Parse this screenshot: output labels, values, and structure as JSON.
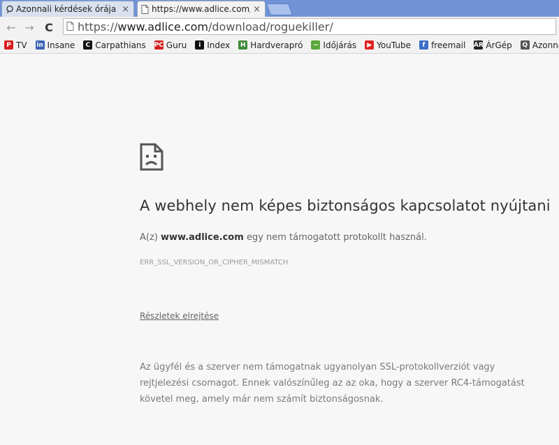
{
  "tabs": [
    {
      "label": "Azonnali kérdések órája",
      "close": "×"
    },
    {
      "label": "https://www.adlice.com/download/roguekiller/",
      "close": "×"
    }
  ],
  "toolbar": {
    "back": "←",
    "forward": "→",
    "reload": "C",
    "url_scheme": "https://",
    "url_host": "www.adlice.com",
    "url_path": "/download/roguekiller/"
  },
  "bookmarks": [
    {
      "label": "TV",
      "icon": "p-icon",
      "color": "#d81e1e",
      "glyph": "P"
    },
    {
      "label": "Insane",
      "icon": "in-icon",
      "color": "#3a63b5",
      "glyph": "in"
    },
    {
      "label": "Carpathians",
      "icon": "c-circle-icon",
      "color": "#111111",
      "glyph": "C"
    },
    {
      "label": "Guru",
      "icon": "pc-icon",
      "color": "#d42020",
      "glyph": "PC"
    },
    {
      "label": "Index",
      "icon": "index-icon",
      "color": "#111111",
      "glyph": "i"
    },
    {
      "label": "Hardverapró",
      "icon": "hardverapro-icon",
      "color": "#3f8a3a",
      "glyph": "H"
    },
    {
      "label": "Időjárás",
      "icon": "frog-icon",
      "color": "#5aa83a",
      "glyph": "~"
    },
    {
      "label": "YouTube",
      "icon": "youtube-icon",
      "color": "#e02424",
      "glyph": "▶"
    },
    {
      "label": "freemail",
      "icon": "freemail-icon",
      "color": "#3b6fc7",
      "glyph": "f"
    },
    {
      "label": "ÁrGép",
      "icon": "argep-icon",
      "color": "#222222",
      "glyph": "ÁR"
    },
    {
      "label": "Azonnali",
      "icon": "azonnali-icon",
      "color": "#555555",
      "glyph": "Q"
    }
  ],
  "error": {
    "heading": "A webhely nem képes biztonságos kapcsolatot nyújtani",
    "desc_prefix": "A(z)",
    "desc_host": "www.adlice.com",
    "desc_suffix": "egy nem támogatott protokollt használ.",
    "code": "ERR_SSL_VERSION_OR_CIPHER_MISMATCH",
    "details_link": "Részletek elrejtése",
    "explanation": "Az ügyfél és a szerver nem támogatnak ugyanolyan SSL-protokollverziót vagy rejtjelezési csomagot. Ennek valószínűleg az az oka, hogy a szerver RC4-támogatást követel meg, amely már nem számít biztonságosnak."
  }
}
